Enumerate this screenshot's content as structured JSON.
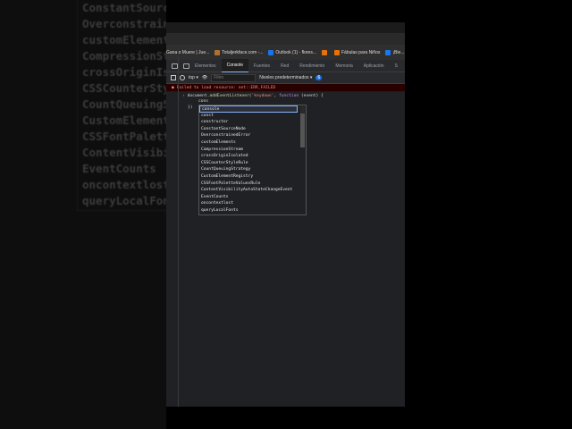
{
  "background_list": [
    "ConstantSourceNode",
    "OverconstrainedError",
    "customElements",
    "CompressionStream",
    "crossOriginIsolated",
    "CSSCounterStyleRule",
    "CountQueuingStrategy",
    "CustomElementRegistry",
    "CSSFontPaletteValuesRule",
    "ContentVisibilityAutoStateChangeEvent",
    "EventCounts",
    "oncontextlost",
    "queryLocalFonts"
  ],
  "bookmarks": [
    {
      "label": "Gana o Muere | Jue...",
      "color": "#555"
    },
    {
      "label": "Totaljerkface.com -...",
      "color": "#b07030"
    },
    {
      "label": "Outlook (1) - flores...",
      "color": "#1a73e8"
    },
    {
      "label": "",
      "color": "#e8710a"
    },
    {
      "label": "Fábulas para Niños",
      "color": "#e8710a"
    },
    {
      "label": "¡Bie...",
      "color": "#1877f2"
    }
  ],
  "devtools": {
    "tabs": [
      "Elementos",
      "Console",
      "Fuentes",
      "Red",
      "Rendimiento",
      "Memoria",
      "Aplicación",
      "S"
    ],
    "active_tab": "Console",
    "context": "top",
    "filter_placeholder": "Filtro",
    "levels": "Niveles predeterminados",
    "issues_count": "6"
  },
  "console": {
    "error": "Failed to load resource: net::ERR_FAILED",
    "code": {
      "obj": "document.",
      "method": "addEventListener",
      "open": "(",
      "arg": "'keydown'",
      ", ": ", ",
      "kw": "function",
      "params": " (event) {"
    },
    "typed": "cons",
    "closing": "})"
  },
  "autocomplete": [
    "console",
    "const",
    "constructor",
    "ConstantSourceNode",
    "OverconstrainedError",
    "customElements",
    "CompressionStream",
    "crossOriginIsolated",
    "CSSCounterStyleRule",
    "CountQueuingStrategy",
    "CustomElementRegistry",
    "CSSFontPaletteValuesRule",
    "ContentVisibilityAutoStateChangeEvent",
    "EventCounts",
    "oncontextlost",
    "queryLocalFonts"
  ]
}
